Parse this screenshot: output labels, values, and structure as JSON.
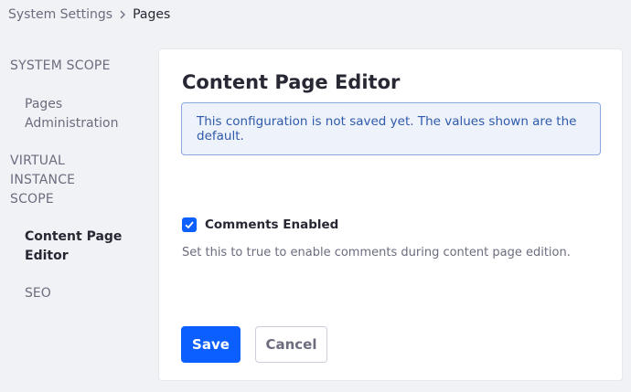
{
  "breadcrumb": {
    "root": "System Settings",
    "current": "Pages"
  },
  "sidebar": {
    "sections": [
      {
        "heading": "SYSTEM SCOPE",
        "items": [
          {
            "label": "Pages Administration",
            "active": false
          }
        ]
      },
      {
        "heading": "VIRTUAL INSTANCE SCOPE",
        "items": [
          {
            "label": "Content Page Editor",
            "active": true
          },
          {
            "label": "SEO",
            "active": false
          }
        ]
      }
    ]
  },
  "main": {
    "title": "Content Page Editor",
    "alert": "This configuration is not saved yet. The values shown are the default.",
    "comments_label": "Comments Enabled",
    "comments_checked": true,
    "comments_help": "Set this to true to enable comments during content page edition.",
    "save_label": "Save",
    "cancel_label": "Cancel"
  },
  "colors": {
    "primary": "#0b5fff",
    "alert_bg": "#eef2fa",
    "alert_border": "#89a7e0",
    "alert_text": "#2e5aac",
    "page_bg": "#f1f2f5"
  }
}
